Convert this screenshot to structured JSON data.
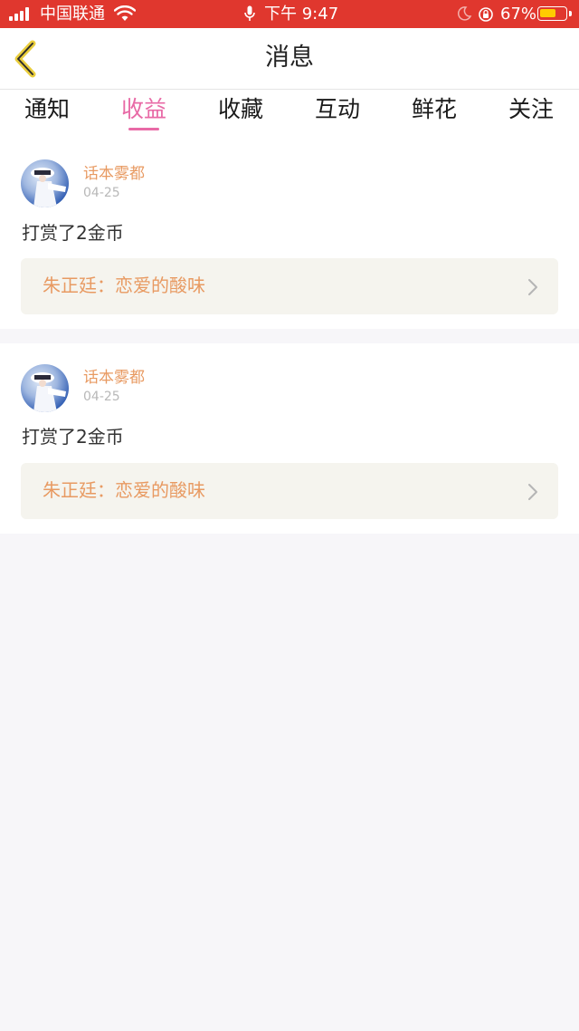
{
  "status_bar": {
    "carrier": "中国联通",
    "time": "下午 9:47",
    "battery": "67%",
    "battery_level": 0.67
  },
  "header": {
    "title": "消息",
    "back_icon": "chevron-left-icon"
  },
  "tabs": [
    {
      "label": "通知",
      "active": false
    },
    {
      "label": "收益",
      "active": true
    },
    {
      "label": "收藏",
      "active": false
    },
    {
      "label": "互动",
      "active": false
    },
    {
      "label": "鲜花",
      "active": false
    },
    {
      "label": "关注",
      "active": false
    }
  ],
  "colors": {
    "status_bar": "#e0372e",
    "active_tab": "#e86aa6",
    "accent_text": "#e89a62",
    "link_box": "#f5f4ee"
  },
  "items": [
    {
      "username": "话本雾都",
      "date": "04-25",
      "message": "打赏了2金币",
      "book": "朱正廷：恋爱的酸味"
    },
    {
      "username": "话本雾都",
      "date": "04-25",
      "message": "打赏了2金币",
      "book": "朱正廷：恋爱的酸味"
    }
  ]
}
